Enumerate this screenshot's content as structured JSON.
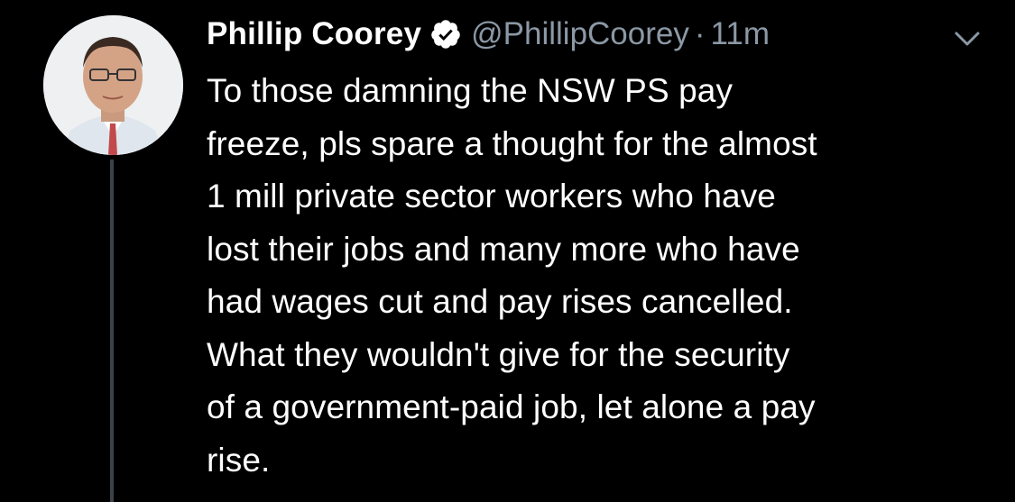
{
  "tweet": {
    "author": {
      "display_name": "Phillip Coorey",
      "handle": "@PhillipCoorey",
      "verified": true,
      "avatar_icon": "profile-photo"
    },
    "separator": "·",
    "timestamp": "11m",
    "menu_icon": "chevron-down-icon",
    "text": "To those damning the NSW PS pay\nfreeze, pls spare a thought for the almost\n1 mill private sector workers who have\nlost their jobs and many more who have\nhad wages cut and pay rises cancelled.\nWhat they wouldn't give for the security\nof a government-paid job, let alone a pay\nrise."
  },
  "colors": {
    "background": "#000000",
    "primary_text": "#ffffff",
    "secondary_text": "#8b98a5",
    "thread_line": "#3d4248"
  }
}
